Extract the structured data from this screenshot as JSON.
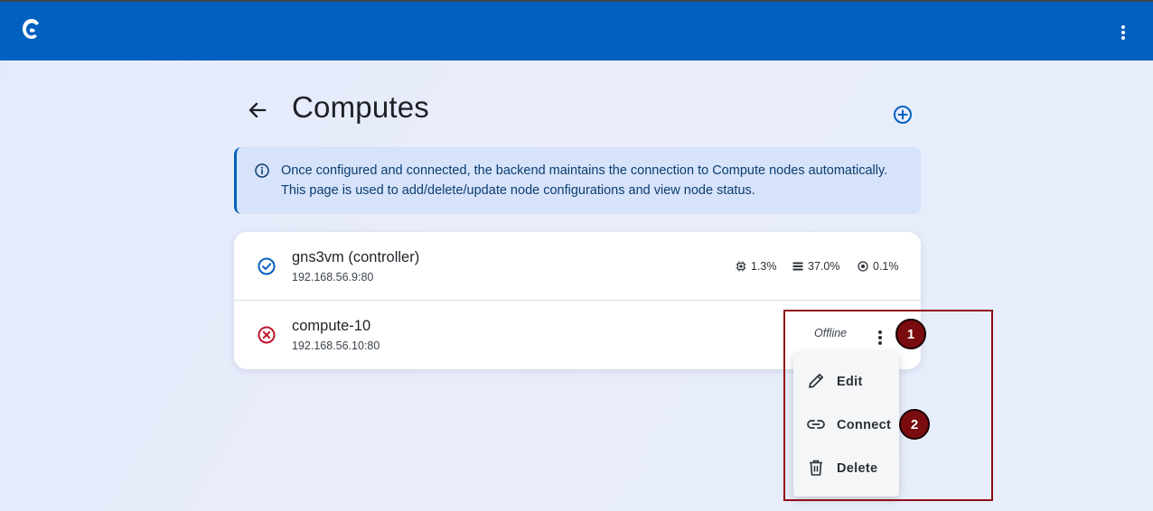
{
  "appbar": {
    "logo_icon": "gns3-chameleon-logo",
    "menu_icon": "more-vert-icon",
    "color": "#0260bf"
  },
  "header": {
    "back_icon": "arrow-back-icon",
    "title": "Computes",
    "add_icon": "add-circle-icon"
  },
  "info_alert": {
    "icon": "info-icon",
    "text": "Once configured and connected, the backend maintains the connection to Compute nodes automatically. This page is used to add/delete/update node configurations and view node status."
  },
  "computes": [
    {
      "name": "gns3vm (controller)",
      "address": "192.168.56.9:80",
      "status_icon": "check-circle-icon",
      "status_color": "#0260bf",
      "stats": {
        "cpu_icon": "cpu-icon",
        "cpu": "1.3%",
        "memory_icon": "memory-icon",
        "memory": "37.0%",
        "disk_icon": "disk-icon",
        "disk": "0.1%"
      }
    },
    {
      "name": "compute-10",
      "address": "192.168.56.10:80",
      "status_icon": "error-circle-icon",
      "status_color": "#c0152a",
      "status_text": "Offline",
      "menu_icon": "more-vert-icon"
    }
  ],
  "context_menu": {
    "items": [
      {
        "label": "Edit",
        "icon": "pencil-icon"
      },
      {
        "label": "Connect",
        "icon": "link-icon"
      },
      {
        "label": "Delete",
        "icon": "trash-icon"
      }
    ]
  },
  "annotations": {
    "badge_1": "1",
    "badge_2": "2",
    "color": "#8f0f14"
  }
}
